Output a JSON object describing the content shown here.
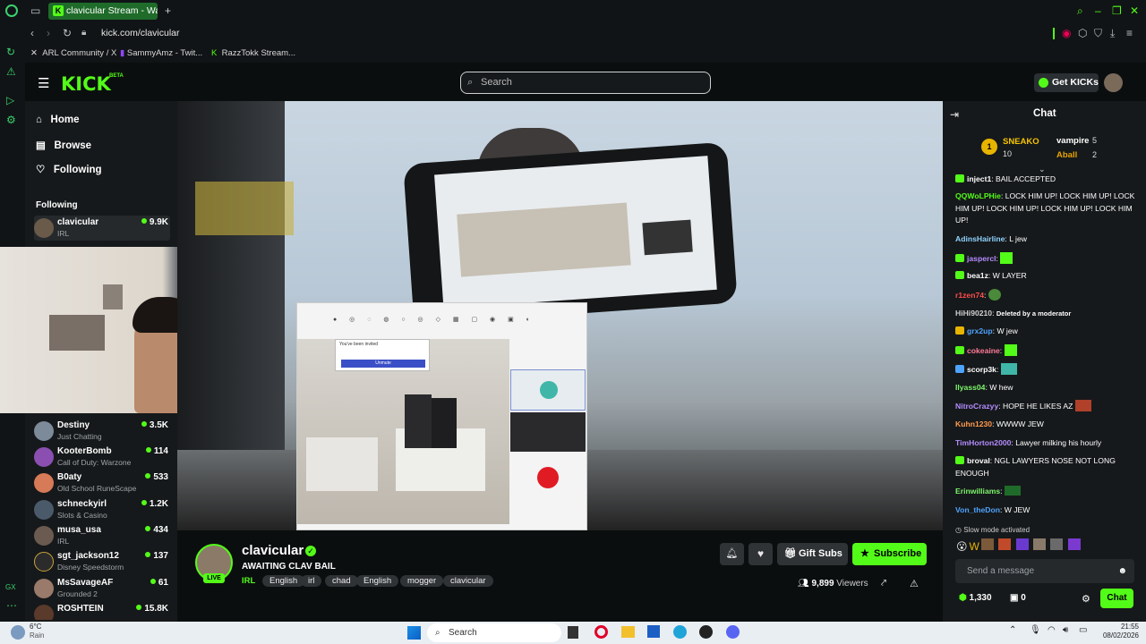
{
  "browser": {
    "tab_title": "clavicular Stream - Wa",
    "url": "kick.com/clavicular",
    "bookmarks": [
      "ARL Community / X",
      "SammyAmz - Twit...",
      "RazzTokk Stream..."
    ]
  },
  "header": {
    "logo": "KICK",
    "beta": "BETA",
    "search_placeholder": "Search",
    "get_kicks": "Get KICKs"
  },
  "sidebar": {
    "nav": [
      "Home",
      "Browse",
      "Following"
    ],
    "section_title": "Following",
    "following": [
      {
        "name": "clavicular",
        "category": "IRL",
        "viewers": "9.9K"
      },
      {
        "name": "Destiny",
        "category": "Just Chatting",
        "viewers": "3.5K"
      },
      {
        "name": "KooterBomb",
        "category": "Call of Duty: Warzone",
        "viewers": "114"
      },
      {
        "name": "B0aty",
        "category": "Old School RuneScape",
        "viewers": "533"
      },
      {
        "name": "schneckyirl",
        "category": "Slots & Casino",
        "viewers": "1.2K"
      },
      {
        "name": "musa_usa",
        "category": "IRL",
        "viewers": "434"
      },
      {
        "name": "sgt_jackson12",
        "category": "Disney Speedstorm",
        "viewers": "137"
      },
      {
        "name": "MsSavageAF",
        "category": "Grounded 2",
        "viewers": "61"
      },
      {
        "name": "ROSHTEIN",
        "category": "",
        "viewers": "15.8K"
      }
    ]
  },
  "video_overlay": {
    "dialog_title": "You've been invited",
    "dialog_button": "Unmute"
  },
  "stream": {
    "channel": "clavicular",
    "title": "AWAITING CLAV BAIL",
    "live": "LIVE",
    "tags": [
      "IRL",
      "English",
      "irl",
      "chad",
      "English",
      "mogger",
      "clavicular"
    ],
    "viewers": "9,899",
    "viewers_label": "Viewers",
    "gift_subs": "Gift Subs",
    "subscribe": "Subscribe"
  },
  "chat": {
    "title": "Chat",
    "leaderboard": [
      {
        "rank": "1",
        "name": "SNEAKO",
        "count": "10"
      },
      {
        "name": "vampire",
        "count": "5"
      },
      {
        "name": "Aball",
        "count": "2"
      }
    ],
    "messages": [
      {
        "user": "inject1",
        "text": "BAIL ACCEPTED",
        "color": "#d0d0d0"
      },
      {
        "user": "QQWoLPHie",
        "text": "LOCK HIM UP! LOCK HIM UP! LOCK HIM UP! LOCK HIM UP! LOCK HIM UP! LOCK HIM UP!",
        "color": "#53fc18"
      },
      {
        "user": "AdinsHairline",
        "text": "L jew",
        "color": "#8fd3ff"
      },
      {
        "user": "jaspercl",
        "text": "",
        "color": "#b48cff"
      },
      {
        "user": "bea1z",
        "text": "W LAYER",
        "color": "#d0d0d0"
      },
      {
        "user": "r1zen74",
        "text": "",
        "color": "#ff4d4d"
      },
      {
        "user": "HiHi90210",
        "text": "Deleted by a moderator",
        "color": "#d0d0d0"
      },
      {
        "user": "grx2up",
        "text": "W jew",
        "color": "#4da3ff"
      },
      {
        "user": "cokeaine",
        "text": "",
        "color": "#ff7a9a"
      },
      {
        "user": "scorp3k",
        "text": "",
        "color": "#d0d0d0"
      },
      {
        "user": "Ilyass04",
        "text": "W hew",
        "color": "#7cf56c"
      },
      {
        "user": "NitroCrazyy",
        "text": "HOPE HE LIKES AZ",
        "color": "#b48cff"
      },
      {
        "user": "Kuhn1230",
        "text": "WWWW JEW",
        "color": "#ff9a4d"
      },
      {
        "user": "TimHorton2000",
        "text": "Lawyer milking his hourly",
        "color": "#b48cff"
      },
      {
        "user": "broval",
        "text": "NGL LAWYERS NOSE NOT LONG ENOUGH",
        "color": "#d0d0d0"
      },
      {
        "user": "Erinwilliams",
        "text": "",
        "color": "#7cf56c"
      },
      {
        "user": "Von_theDon",
        "text": "W JEW",
        "color": "#4da3ff"
      }
    ],
    "slow_mode": "Slow mode activated",
    "input_placeholder": "Send a message",
    "points": "1,330",
    "gifts": "0",
    "send": "Chat"
  },
  "taskbar": {
    "temp": "6°C",
    "weather": "Rain",
    "search": "Search",
    "time": "21:55",
    "date": "08/02/2026"
  },
  "colors": {
    "accent": "#53fc18",
    "bg": "#0b0e0f",
    "panel": "#16191b"
  }
}
